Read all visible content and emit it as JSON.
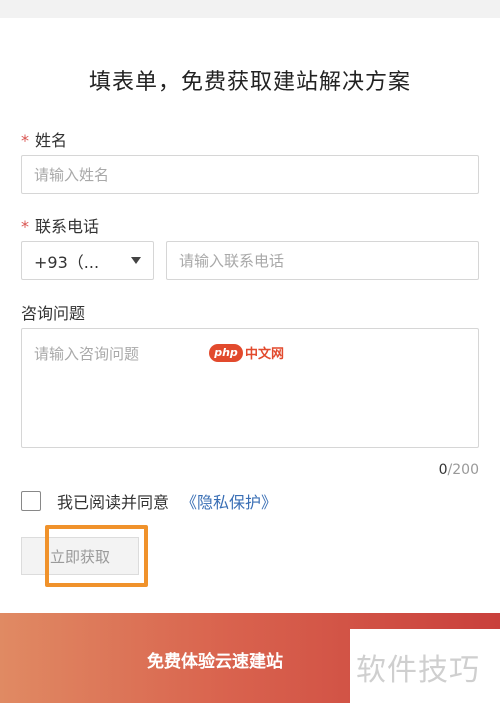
{
  "form": {
    "title": "填表单，免费获取建站解决方案",
    "required_mark": "*",
    "name": {
      "label": "姓名",
      "placeholder": "请输入姓名"
    },
    "phone": {
      "label": "联系电话",
      "country_code": "+93（...",
      "placeholder": "请输入联系电话"
    },
    "question": {
      "label": "咨询问题",
      "placeholder": "请输入咨询问题",
      "counter_current": "0",
      "counter_max": "/200"
    },
    "agreement": {
      "text": "我已阅读并同意",
      "link": "《隐私保护》",
      "checked": false
    },
    "submit_label": "立即获取"
  },
  "banner": {
    "text": "免费体验云速建站"
  },
  "watermarks": {
    "php_logo": "php",
    "php_site": "中文网",
    "corner": "软件技巧"
  },
  "colors": {
    "required": "#d9534f",
    "link": "#3a6fb5",
    "highlight": "#f0922b",
    "banner_start": "#e08a63",
    "banner_end": "#c9403c"
  }
}
